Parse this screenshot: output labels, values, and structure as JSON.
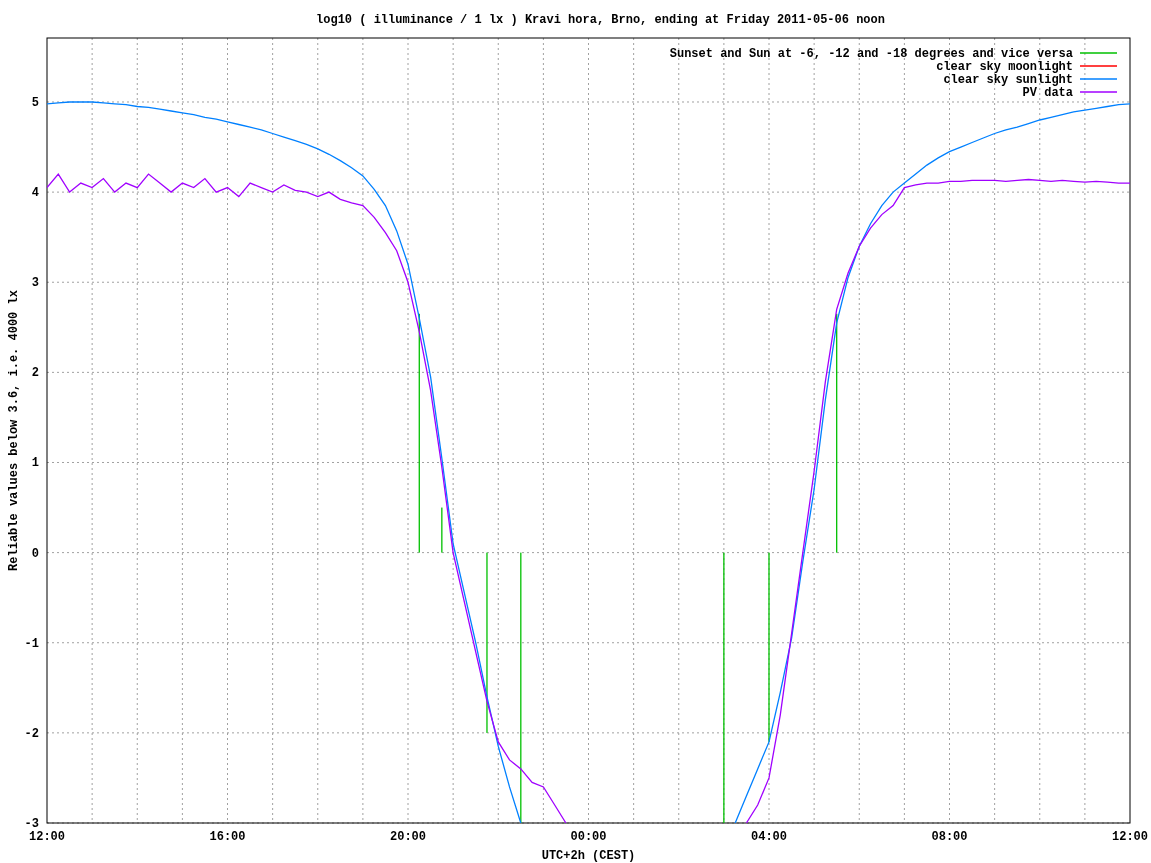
{
  "chart_data": {
    "type": "line",
    "title": "log10 ( illuminance / 1 lx ) Kravi hora, Brno, ending at Friday 2011-05-06 noon",
    "xlabel": "UTC+2h (CEST)",
    "ylabel": "Reliable values below 3.6, i.e. 4000 lx",
    "grid": true,
    "legend": true,
    "categories": [
      "12:00",
      null,
      null,
      null,
      null,
      null,
      null,
      null,
      null,
      null,
      null,
      null,
      null,
      null,
      null,
      null,
      "16:00",
      null,
      null,
      null,
      null,
      null,
      null,
      null,
      null,
      null,
      null,
      null,
      null,
      null,
      null,
      null,
      "20:00",
      null,
      null,
      null,
      null,
      null,
      null,
      null,
      null,
      null,
      null,
      null,
      null,
      null,
      null,
      null,
      "00:00",
      null,
      null,
      null,
      null,
      null,
      null,
      null,
      null,
      null,
      null,
      null,
      null,
      null,
      null,
      null,
      "04:00",
      null,
      null,
      null,
      null,
      null,
      null,
      null,
      null,
      null,
      null,
      null,
      null,
      null,
      null,
      null,
      "08:00",
      null,
      null,
      null,
      null,
      null,
      null,
      null,
      null,
      null,
      null,
      null,
      null,
      null,
      null,
      null,
      "12:00"
    ],
    "ylim": [
      -3,
      5.71
    ],
    "yticks": [
      -3,
      -2,
      -1,
      0,
      1,
      2,
      3,
      4,
      5
    ],
    "series": [
      {
        "name": "Sunset and Sun at -6, -12 and -18 degrees and vice versa",
        "color": "#00c000",
        "type": "bar",
        "values": [
          null,
          null,
          null,
          null,
          null,
          null,
          null,
          null,
          null,
          null,
          null,
          null,
          null,
          null,
          null,
          null,
          null,
          null,
          null,
          null,
          null,
          null,
          null,
          null,
          null,
          null,
          null,
          null,
          null,
          null,
          null,
          null,
          null,
          2.65,
          null,
          0.5,
          null,
          null,
          null,
          -2.0,
          null,
          null,
          -3,
          null,
          null,
          null,
          null,
          null,
          null,
          null,
          null,
          null,
          null,
          null,
          null,
          null,
          null,
          null,
          null,
          null,
          -3,
          null,
          null,
          null,
          -2.1,
          null,
          null,
          null,
          null,
          null,
          2.65,
          null,
          null,
          null,
          null,
          null,
          null,
          null,
          null,
          null,
          null,
          null,
          null,
          null,
          null,
          null,
          null,
          null,
          null,
          null,
          null,
          null,
          null,
          null,
          null,
          null,
          null
        ]
      },
      {
        "name": "clear sky moonlight",
        "color": "#ff0000",
        "values": [
          null,
          null,
          null,
          null,
          null,
          null,
          null,
          null,
          null,
          null,
          null,
          null,
          null,
          null,
          null,
          null,
          null,
          null,
          null,
          null,
          null,
          null,
          null,
          null,
          null,
          null,
          null,
          null,
          null,
          null,
          null,
          null,
          null,
          null,
          null,
          null,
          null,
          null,
          null,
          null,
          null,
          null,
          null,
          null,
          null,
          null,
          null,
          null,
          null,
          null,
          null,
          null,
          null,
          null,
          null,
          null,
          null,
          null,
          null,
          null,
          null,
          null,
          null,
          null,
          null,
          null,
          null,
          null,
          null,
          null,
          null,
          null,
          null,
          null,
          null,
          null,
          null,
          null,
          null,
          null,
          null,
          null,
          null,
          null,
          null,
          null,
          null,
          null,
          null,
          null,
          null,
          null,
          null,
          null,
          null,
          null,
          null
        ]
      },
      {
        "name": "clear sky sunlight",
        "color": "#0080ff",
        "values": [
          4.98,
          4.99,
          5.0,
          5.0,
          5.0,
          4.99,
          4.98,
          4.97,
          4.95,
          4.94,
          4.92,
          4.9,
          4.88,
          4.86,
          4.83,
          4.81,
          4.78,
          4.75,
          4.72,
          4.69,
          4.65,
          4.61,
          4.57,
          4.53,
          4.48,
          4.42,
          4.35,
          4.27,
          4.18,
          4.03,
          3.85,
          3.57,
          3.2,
          2.6,
          1.95,
          1.05,
          0.1,
          -0.45,
          -1.0,
          -1.6,
          -2.15,
          -2.6,
          -3,
          null,
          null,
          null,
          null,
          null,
          null,
          null,
          null,
          null,
          null,
          null,
          null,
          null,
          null,
          null,
          null,
          null,
          null,
          -3,
          -2.7,
          -2.4,
          -2.1,
          -1.55,
          -0.95,
          -0.1,
          0.7,
          1.7,
          2.55,
          3.05,
          3.4,
          3.65,
          3.85,
          4.0,
          4.1,
          4.2,
          4.3,
          4.38,
          4.45,
          4.5,
          4.55,
          4.6,
          4.65,
          4.69,
          4.72,
          4.76,
          4.8,
          4.83,
          4.86,
          4.89,
          4.91,
          4.93,
          4.95,
          4.97,
          4.98
        ]
      },
      {
        "name": "PV data",
        "color": "#a000ff",
        "values": [
          4.05,
          4.2,
          4.0,
          4.1,
          4.05,
          4.15,
          4.0,
          4.1,
          4.05,
          4.2,
          4.1,
          4.0,
          4.1,
          4.05,
          4.15,
          4.0,
          4.05,
          3.95,
          4.1,
          4.05,
          4.0,
          4.08,
          4.02,
          4.0,
          3.95,
          4.0,
          3.92,
          3.88,
          3.85,
          3.72,
          3.55,
          3.35,
          3.0,
          2.45,
          1.8,
          0.95,
          0.0,
          -0.55,
          -1.1,
          -1.65,
          -2.1,
          -2.3,
          -2.4,
          -2.55,
          -2.6,
          -2.8,
          -3,
          null,
          null,
          null,
          null,
          null,
          null,
          null,
          null,
          null,
          null,
          null,
          null,
          null,
          null,
          null,
          -3,
          -2.8,
          -2.5,
          -1.8,
          -0.9,
          0.0,
          0.9,
          1.9,
          2.7,
          3.1,
          3.4,
          3.6,
          3.75,
          3.85,
          4.05,
          4.08,
          4.1,
          4.1,
          4.12,
          4.12,
          4.13,
          4.13,
          4.13,
          4.12,
          4.13,
          4.14,
          4.13,
          4.12,
          4.13,
          4.12,
          4.11,
          4.12,
          4.11,
          4.1,
          4.1
        ]
      }
    ]
  }
}
